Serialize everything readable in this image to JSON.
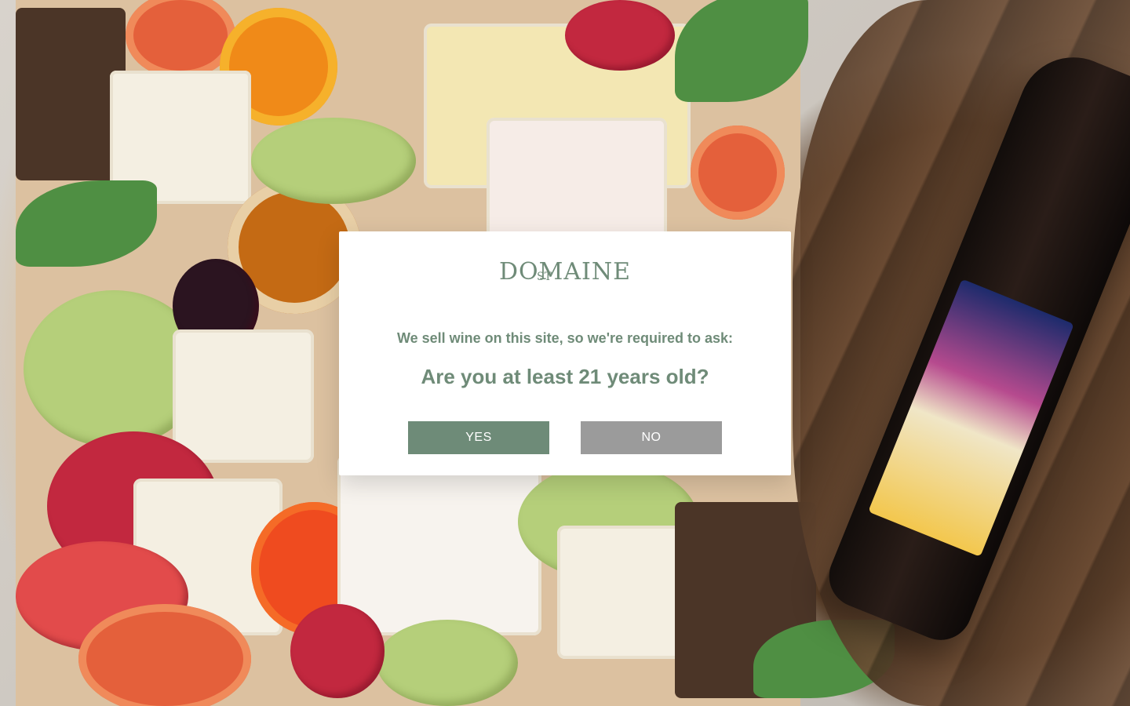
{
  "modal": {
    "logo_text": "DOMAINE",
    "logo_monogram": "ST",
    "prompt": "We sell wine on this site, so we're required to ask:",
    "question": "Are you at least 21 years old?",
    "yes_label": "YES",
    "no_label": "NO"
  },
  "colors": {
    "accent": "#6e8b78",
    "secondary_button": "#9b9b9b",
    "modal_bg": "#ffffff"
  }
}
